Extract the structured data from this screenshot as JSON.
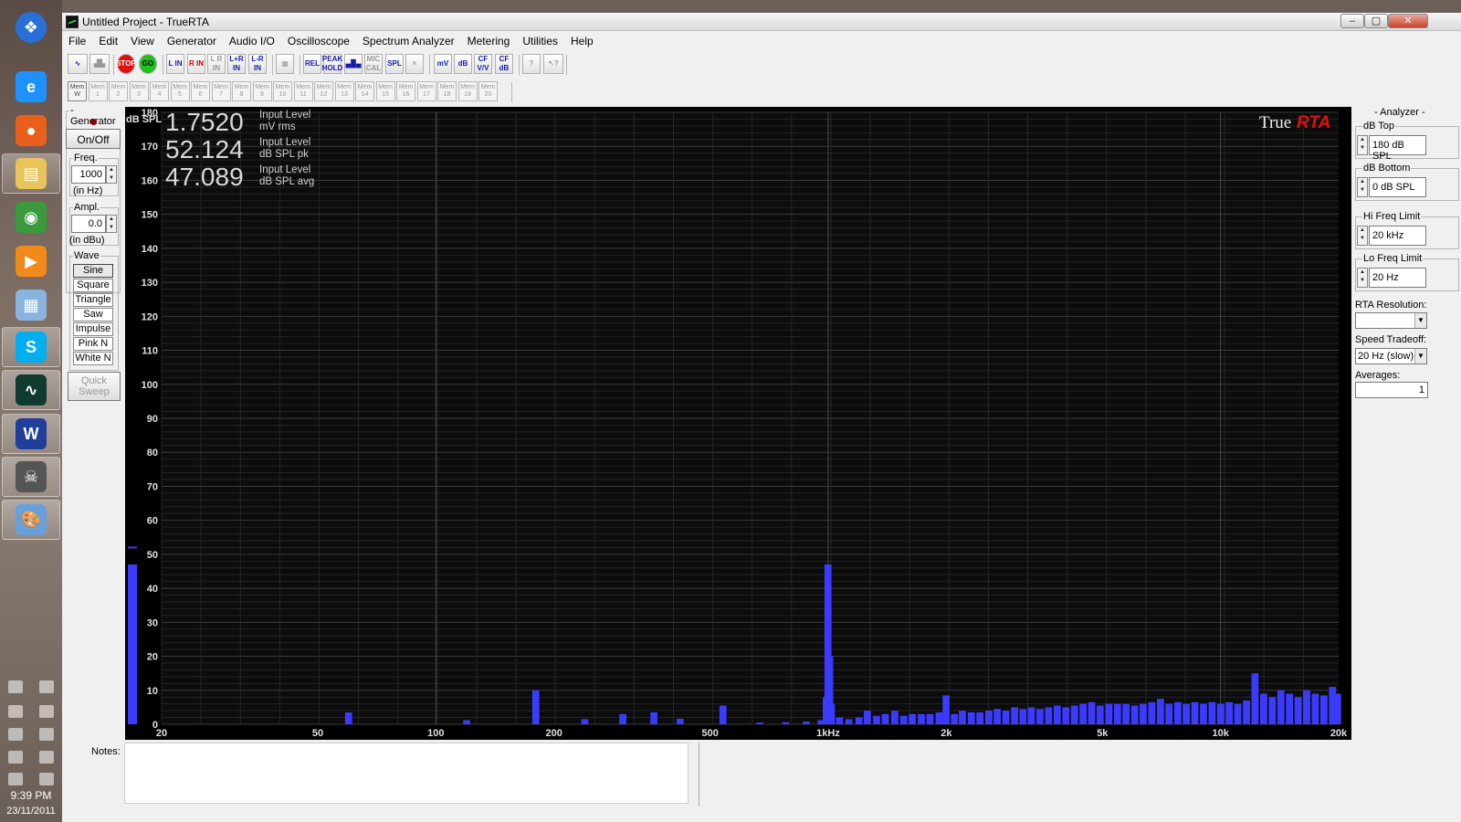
{
  "taskbar": {
    "apps": [
      {
        "name": "windows-start-icon",
        "color": "#2a6fd8",
        "glyph": "❖"
      },
      {
        "name": "internet-explorer-icon",
        "color": "#1e90ff",
        "glyph": "e"
      },
      {
        "name": "firefox-icon",
        "color": "#e8601c",
        "glyph": "●"
      },
      {
        "name": "file-explorer-icon",
        "color": "#e8c45a",
        "glyph": "▤"
      },
      {
        "name": "chrome-icon",
        "color": "#3b9a3b",
        "glyph": "◉"
      },
      {
        "name": "media-player-icon",
        "color": "#f08a1a",
        "glyph": "▶"
      },
      {
        "name": "calculator-icon",
        "color": "#8ab4e0",
        "glyph": "▦"
      },
      {
        "name": "skype-icon",
        "color": "#00aff0",
        "glyph": "S"
      },
      {
        "name": "truerta-oscilloscope-icon",
        "color": "#0f3a2f",
        "glyph": "∿"
      },
      {
        "name": "word-icon",
        "color": "#1f3f9a",
        "glyph": "W"
      },
      {
        "name": "alien-app-icon",
        "color": "#555555",
        "glyph": "☠"
      },
      {
        "name": "paint-icon",
        "color": "#6aa0d8",
        "glyph": "🎨"
      }
    ],
    "clock_time": "9:39 PM",
    "clock_date": "23/11/2011"
  },
  "window": {
    "title": "Untitled Project - TrueRTA",
    "controls": {
      "minimize": "–",
      "maximize": "▢",
      "close": "✕"
    }
  },
  "menu": [
    "File",
    "Edit",
    "View",
    "Generator",
    "Audio I/O",
    "Oscilloscope",
    "Spectrum Analyzer",
    "Metering",
    "Utilities",
    "Help"
  ],
  "toolbar1": [
    {
      "label": "∿",
      "name": "oscilloscope-view-button",
      "cls": ""
    },
    {
      "label": "▟▙",
      "name": "spectrum-view-button",
      "cls": "grey"
    },
    {
      "label": "STOP",
      "name": "stop-button",
      "cls": "red"
    },
    {
      "label": "GO",
      "name": "go-button",
      "cls": ""
    },
    {
      "label": "L IN",
      "name": "left-in-button",
      "cls": ""
    },
    {
      "label": "R IN",
      "name": "right-in-button",
      "cls": "red"
    },
    {
      "label": "L R IN",
      "name": "stereo-in-button",
      "cls": "grey"
    },
    {
      "label": "L+R IN",
      "name": "sum-in-button",
      "cls": ""
    },
    {
      "label": "L-R IN",
      "name": "diff-in-button",
      "cls": ""
    },
    {
      "label": "▦",
      "name": "grid-button",
      "cls": "grey"
    },
    {
      "label": "REL",
      "name": "relative-button",
      "cls": ""
    },
    {
      "label": "PEAK HOLD",
      "name": "peak-hold-button",
      "cls": ""
    },
    {
      "label": "▄█▄",
      "name": "bars-button",
      "cls": ""
    },
    {
      "label": "MIC CAL",
      "name": "mic-cal-button",
      "cls": "grey"
    },
    {
      "label": "SPL",
      "name": "spl-button",
      "cls": ""
    },
    {
      "label": "✕",
      "name": "clear-button",
      "cls": "grey"
    },
    {
      "label": "mV",
      "name": "mv-button",
      "cls": ""
    },
    {
      "label": "dB",
      "name": "db-button",
      "cls": ""
    },
    {
      "label": "CF V/V",
      "name": "cf-vv-button",
      "cls": ""
    },
    {
      "label": "CF dB",
      "name": "cf-db-button",
      "cls": ""
    },
    {
      "label": "?",
      "name": "help-button",
      "cls": "grey"
    },
    {
      "label": "↖?",
      "name": "context-help-button",
      "cls": "grey"
    }
  ],
  "memories": [
    "Mem W",
    "Mem 1",
    "Mem 2",
    "Mem 3",
    "Mem 4",
    "Mem 5",
    "Mem 6",
    "Mem 7",
    "Mem 8",
    "Mem 9",
    "Mem 10",
    "Mem 11",
    "Mem 12",
    "Mem 13",
    "Mem 14",
    "Mem 15",
    "Mem 16",
    "Mem 17",
    "Mem 18",
    "Mem 19",
    "Mem 20"
  ],
  "generator": {
    "title": "- Generator -",
    "onoff": "On/Off",
    "freq_label": "Freq.",
    "freq_value": "1000",
    "freq_unit": "(in Hz)",
    "ampl_label": "Ampl.",
    "ampl_value": "0.0",
    "ampl_unit": "(in dBu)",
    "wave_label": "Wave",
    "waves": [
      "Sine",
      "Square",
      "Triangle",
      "Saw",
      "Impulse",
      "Pink N",
      "White N"
    ],
    "quick_sweep": "Quick Sweep"
  },
  "readouts": [
    {
      "value": "1.7520",
      "line1": "Input Level",
      "line2": "mV rms"
    },
    {
      "value": "52.124",
      "line1": "Input Level",
      "line2": "dB SPL pk"
    },
    {
      "value": "47.089",
      "line1": "Input Level",
      "line2": "dB SPL avg"
    }
  ],
  "brand": {
    "part1": "True",
    "part2": "RTA"
  },
  "analyzer": {
    "title": "- Analyzer -",
    "db_top_label": "dB Top",
    "db_top": "180 dB SPL",
    "db_bottom_label": "dB Bottom",
    "db_bottom": "0 dB SPL",
    "hi_freq_label": "Hi Freq Limit",
    "hi_freq": "20 kHz",
    "lo_freq_label": "Lo Freq Limit",
    "lo_freq": "20 Hz",
    "rta_res_label": "RTA Resolution:",
    "rta_res": "",
    "speed_label": "Speed Tradeoff:",
    "speed": "20 Hz (slow)",
    "averages_label": "Averages:",
    "averages": "1"
  },
  "notes": {
    "label": "Notes:"
  },
  "chart_data": {
    "type": "bar",
    "ylabel": "dB SPL",
    "ylim": [
      0,
      180
    ],
    "xscale": "log",
    "xlim": [
      20,
      20000
    ],
    "yticks": [
      0,
      10,
      20,
      30,
      40,
      50,
      60,
      70,
      80,
      90,
      100,
      110,
      120,
      130,
      140,
      150,
      160,
      170,
      180
    ],
    "xticks": [
      {
        "v": 20,
        "label": "20"
      },
      {
        "v": 50,
        "label": "50"
      },
      {
        "v": 100,
        "label": "100"
      },
      {
        "v": 200,
        "label": "200"
      },
      {
        "v": 500,
        "label": "500"
      },
      {
        "v": 1000,
        "label": "1kHz"
      },
      {
        "v": 2000,
        "label": "2k"
      },
      {
        "v": 5000,
        "label": "5k"
      },
      {
        "v": 10000,
        "label": "10k"
      },
      {
        "v": 20000,
        "label": "20k"
      }
    ],
    "level_meter": {
      "value": 47,
      "peak": 52
    },
    "bar_color": "#3b3bff",
    "bars": [
      [
        60,
        3.5
      ],
      [
        120,
        1.2
      ],
      [
        180,
        10
      ],
      [
        240,
        1.5
      ],
      [
        300,
        3
      ],
      [
        360,
        3.5
      ],
      [
        420,
        1.6
      ],
      [
        540,
        5.5
      ],
      [
        670,
        0.5
      ],
      [
        780,
        0.6
      ],
      [
        880,
        0.8
      ],
      [
        960,
        1.2
      ],
      [
        990,
        8
      ],
      [
        1000,
        47
      ],
      [
        1010,
        20
      ],
      [
        1020,
        6
      ],
      [
        1070,
        2
      ],
      [
        1130,
        1.5
      ],
      [
        1200,
        2
      ],
      [
        1260,
        4
      ],
      [
        1330,
        2.5
      ],
      [
        1400,
        3
      ],
      [
        1480,
        4
      ],
      [
        1560,
        2.5
      ],
      [
        1640,
        3
      ],
      [
        1730,
        3
      ],
      [
        1820,
        3
      ],
      [
        1920,
        3.5
      ],
      [
        2000,
        8.5
      ],
      [
        2100,
        3
      ],
      [
        2200,
        4
      ],
      [
        2320,
        3.5
      ],
      [
        2440,
        3.5
      ],
      [
        2570,
        4
      ],
      [
        2700,
        4.5
      ],
      [
        2840,
        4
      ],
      [
        2990,
        5
      ],
      [
        3140,
        4.5
      ],
      [
        3300,
        5
      ],
      [
        3470,
        4.5
      ],
      [
        3650,
        5
      ],
      [
        3840,
        5.5
      ],
      [
        4040,
        5
      ],
      [
        4250,
        5.5
      ],
      [
        4470,
        6
      ],
      [
        4700,
        6.5
      ],
      [
        4940,
        5.5
      ],
      [
        5200,
        6
      ],
      [
        5470,
        6
      ],
      [
        5750,
        6
      ],
      [
        6050,
        5.5
      ],
      [
        6360,
        6
      ],
      [
        6690,
        6.5
      ],
      [
        7040,
        7.5
      ],
      [
        7400,
        6
      ],
      [
        7790,
        6.5
      ],
      [
        8190,
        6
      ],
      [
        8610,
        6.5
      ],
      [
        9060,
        6
      ],
      [
        9530,
        6.5
      ],
      [
        10020,
        6
      ],
      [
        10540,
        6.5
      ],
      [
        11080,
        6
      ],
      [
        11660,
        7
      ],
      [
        12260,
        15
      ],
      [
        12900,
        9
      ],
      [
        13570,
        8
      ],
      [
        14270,
        10
      ],
      [
        15010,
        9
      ],
      [
        15790,
        8
      ],
      [
        16600,
        10
      ],
      [
        17460,
        9
      ],
      [
        18370,
        8.5
      ],
      [
        19320,
        11
      ],
      [
        19900,
        9
      ]
    ]
  }
}
